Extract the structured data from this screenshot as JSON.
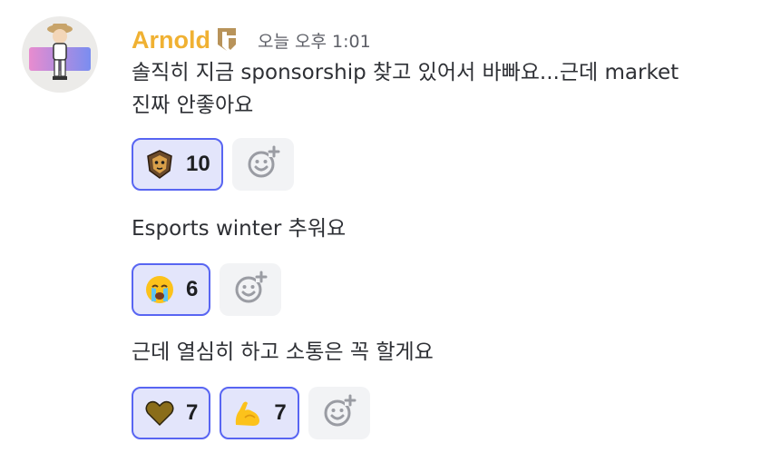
{
  "message": {
    "author": "Arnold",
    "timestamp": "오늘 오후 1:01",
    "colors": {
      "author": "#f0b132",
      "reaction_bg": "#e3e5fb",
      "reaction_border": "#5865f2"
    }
  },
  "lines": [
    {
      "text_1": "솔직히 지금 sponsorship 찾고 있어서 바빠요...근데 market",
      "text_2": "진짜 안좋아요"
    },
    {
      "text_1": "Esports winter 추워요"
    },
    {
      "text_1": "근데 열심히 하고 소통은 꼭 할게요"
    }
  ],
  "reactions": [
    [
      {
        "icon": "tiger-emblem-icon",
        "count": "10"
      }
    ],
    [
      {
        "icon": "crying-face-icon",
        "count": "6"
      }
    ],
    [
      {
        "icon": "heart-icon",
        "count": "7"
      },
      {
        "icon": "flexed-biceps-icon",
        "count": "7"
      }
    ]
  ],
  "add_reaction_icon": "add-reaction-icon"
}
